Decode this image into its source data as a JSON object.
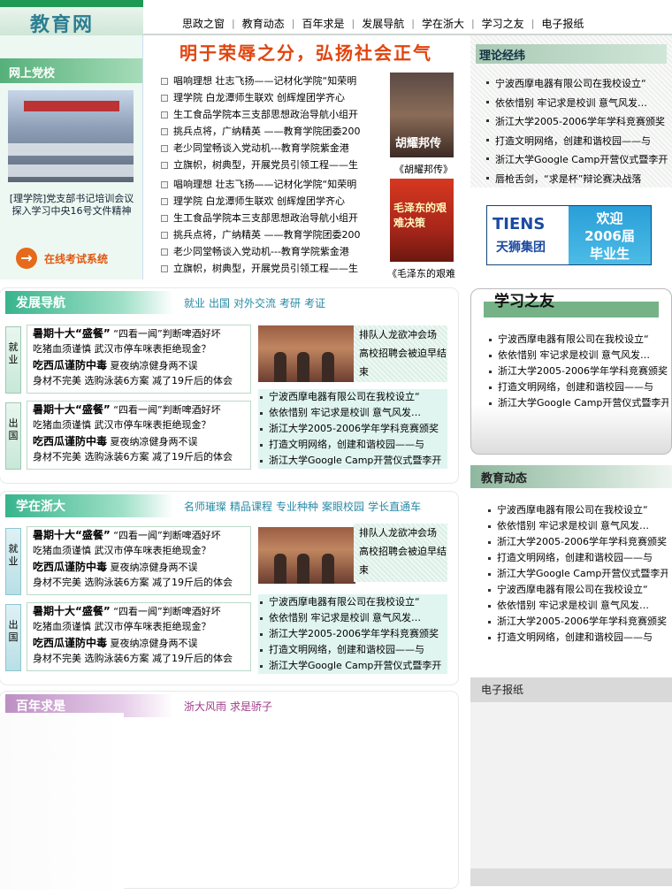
{
  "site": {
    "logo": "教育网"
  },
  "nav": [
    "思政之窗",
    "教育动态",
    "百年求是",
    "发展导航",
    "学在浙大",
    "学习之友",
    "电子报纸"
  ],
  "online_school": {
    "title": "网上党校",
    "caption": "[理学院]党支部书记培训会议 探入学习中央16号文件精神",
    "exam_link": "在线考试系统"
  },
  "slogan": "明于荣辱之分，弘扬社会正气",
  "center_news_1": [
    "唱响理想 壮志飞扬——记材化学院“知荣明",
    "理学院 白龙潭师生联欢 创辉煌团学齐心",
    "生工食品学院本三支部思想政治导航小组开",
    "挑兵点将，广纳精英 ——教育学院团委200",
    "老少同堂畅谈入党动机---教育学院紫金港",
    "立旗帜，树典型，开展党员引领工程——生"
  ],
  "center_news_2": [
    "唱响理想 壮志飞扬——记材化学院“知荣明",
    "理学院 白龙潭师生联欢 创辉煌团学齐心",
    "生工食品学院本三支部思想政治导航小组开",
    "挑兵点将，广纳精英 ——教育学院团委200",
    "老少同堂畅谈入党动机---教育学院紫金港",
    "立旗帜，树典型，开展党员引领工程——生"
  ],
  "books": [
    {
      "cover_text": "胡耀邦传",
      "caption": "《胡耀邦传》"
    },
    {
      "cover_text": "毛泽东的艰难决策",
      "caption": "《毛泽东的艰难"
    }
  ],
  "theory": {
    "title": "理论经纬",
    "items": [
      "宁波西摩电器有限公司在我校设立“",
      "依依惜别 牢记求是校训 意气风发…",
      "浙江大学2005-2006学年学科竞赛颁奖",
      "打造文明网络，创建和谐校园——与",
      "浙江大学Google Camp开营仪式暨李开",
      "唇枪舌剑，“求是杯”辩论赛决战落"
    ]
  },
  "ad": {
    "brand": "TIENS",
    "name_cn": "天狮集团",
    "slogan_line1": "欢迎",
    "slogan_line2": "2006届",
    "slogan_line3": "毕业生"
  },
  "section_dev": {
    "title": "发展导航",
    "links": [
      "就业",
      "出国",
      "对外交流",
      "考研",
      "考证"
    ],
    "tab1": "就业",
    "tab2": "出国",
    "box_lines": [
      {
        "bold": "暑期十大“盛餐”",
        "rest": "“四看一闻”判断啤酒好坏"
      },
      {
        "bold": "",
        "rest": "吃猪血须谨慎 武汉市停车咪表拒绝现金？"
      },
      {
        "bold": "吃西瓜谨防中毒",
        "rest": "夏夜纳凉健身两不误"
      },
      {
        "bold": "",
        "rest": "身材不完美 选购泳装6方案 减了19斤后的体会"
      }
    ],
    "photo_text": "排队人龙欲冲会场 高校招聘会被迫早结束",
    "list": [
      "宁波西摩电器有限公司在我校设立“",
      "依依惜别 牢记求是校训 意气风发…",
      "浙江大学2005-2006学年学科竞赛颁奖",
      "打造文明网络，创建和谐校园——与",
      "浙江大学Google Camp开营仪式暨李开"
    ]
  },
  "section_zju": {
    "title": "学在浙大",
    "links": [
      "名师璀璨",
      "精品课程",
      "专业种种",
      "案眼校园",
      "学长直通车"
    ],
    "tab1": "就业",
    "tab2": "出国",
    "box_lines": [
      {
        "bold": "暑期十大“盛餐”",
        "rest": "“四看一闻”判断啤酒好坏"
      },
      {
        "bold": "",
        "rest": "吃猪血须谨慎 武汉市停车咪表拒绝现金？"
      },
      {
        "bold": "吃西瓜谨防中毒",
        "rest": "夏夜纳凉健身两不误"
      },
      {
        "bold": "",
        "rest": "身材不完美 选购泳装6方案 减了19斤后的体会"
      }
    ],
    "photo_text": "排队人龙欲冲会场 高校招聘会被迫早结束",
    "list": [
      "宁波西摩电器有限公司在我校设立“",
      "依依惜别 牢记求是校训 意气风发…",
      "浙江大学2005-2006学年学科竞赛颁奖",
      "打造文明网络，创建和谐校园——与",
      "浙江大学Google Camp开营仪式暨李开"
    ]
  },
  "section_century": {
    "title": "百年求是",
    "links": [
      "浙大风雨",
      "求是骄子"
    ]
  },
  "study_friend": {
    "title": "学习之友",
    "items": [
      "宁波西摩电器有限公司在我校设立“",
      "依依惜别 牢记求是校训 意气风发…",
      "浙江大学2005-2006学年学科竞赛颁奖",
      "打造文明网络，创建和谐校园——与",
      "浙江大学Google Camp开营仪式暨李开"
    ]
  },
  "edu_news": {
    "title": "教育动态",
    "items": [
      "宁波西摩电器有限公司在我校设立“",
      "依依惜别 牢记求是校训 意气风发…",
      "浙江大学2005-2006学年学科竞赛颁奖",
      "打造文明网络，创建和谐校园——与",
      "浙江大学Google Camp开营仪式暨李开",
      "宁波西摩电器有限公司在我校设立“",
      "依依惜别 牢记求是校训 意气风发…",
      "浙江大学2005-2006学年学科竞赛颁奖",
      "打造文明网络，创建和谐校园——与"
    ]
  },
  "e_paper": {
    "title": "电子报纸"
  },
  "colors": {
    "accent_green": "#1e9a55",
    "slogan_orange": "#e0440e",
    "link_teal": "#2a8aa6",
    "link_purple": "#a03a8a"
  }
}
